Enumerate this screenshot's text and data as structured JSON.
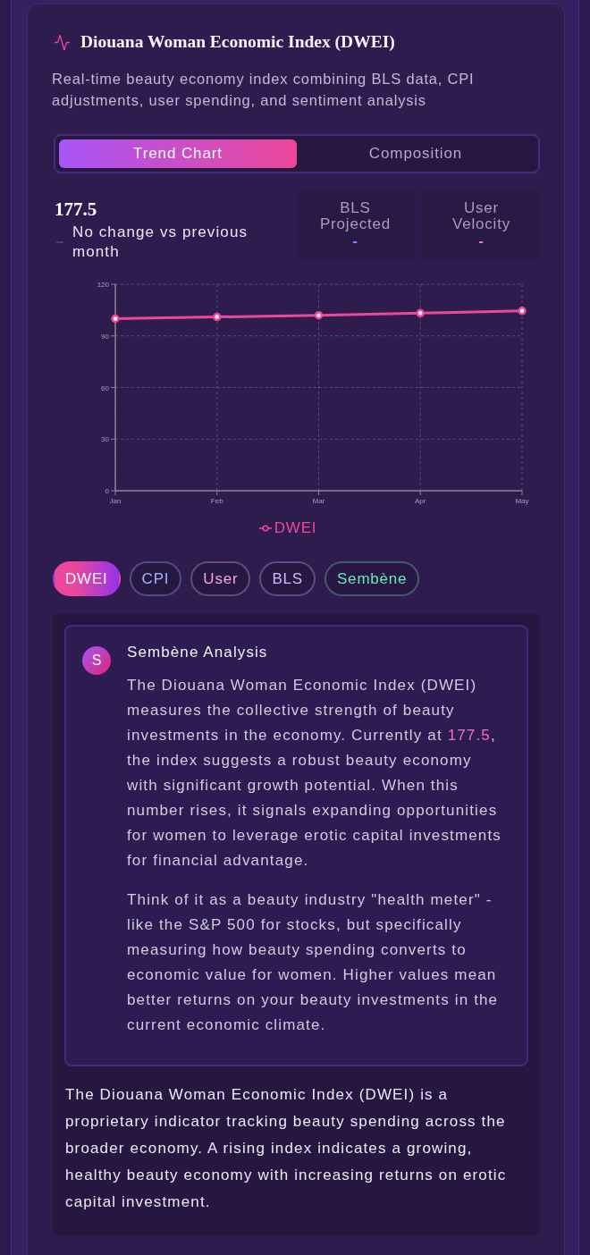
{
  "header": {
    "title": "Diouana Woman Economic Index (DWEI)",
    "subtitle": "Real-time beauty economy index combining BLS data, CPI adjustments, user spending, and sentiment analysis"
  },
  "tabs": [
    {
      "label": "Trend Chart",
      "selected": true
    },
    {
      "label": "Composition",
      "selected": false
    }
  ],
  "summary": {
    "value": "177.5",
    "change": "No change vs previous month"
  },
  "stats": [
    {
      "label": "BLS Projected",
      "value": "-",
      "color": "#818cf8"
    },
    {
      "label": "User Velocity",
      "value": "-",
      "color": "#f472b6"
    }
  ],
  "chart": {
    "chart_data": {
      "type": "line",
      "grid": true,
      "categories": [
        "Jan",
        "Feb",
        "Mar",
        "Apr",
        "May"
      ],
      "series": [
        {
          "name": "DWEI",
          "color": "#ec4899",
          "marker": "circle",
          "values": [
            100,
            101,
            102,
            103.2,
            104.5
          ]
        }
      ],
      "ylim": [
        0,
        120
      ],
      "yticks": [
        0,
        30,
        60,
        90,
        120
      ]
    }
  },
  "filters": [
    {
      "label": "DWEI",
      "selected": true,
      "color": "#ec4899"
    },
    {
      "label": "CPI",
      "selected": false,
      "color": "#a5b4fc"
    },
    {
      "label": "User",
      "selected": false,
      "color": "#f9a8d4"
    },
    {
      "label": "BLS",
      "selected": false,
      "color": "#d8b4fe"
    },
    {
      "label": "Sembène",
      "selected": false,
      "color": "#6ee7b7"
    }
  ],
  "analysis": {
    "avatar": "S",
    "title": "Sembène Analysis",
    "paragraphs": [
      {
        "segments": [
          {
            "text": "The Diouana Woman Economic Index (DWEI) measures the collective strength of beauty investments in the economy. Currently at ",
            "highlight": false
          },
          {
            "text": "177.5",
            "highlight": true
          },
          {
            "text": ", the index suggests a robust beauty economy with significant growth potential. When this number rises, it signals expanding opportunities for women to leverage erotic capital investments for financial advantage.",
            "highlight": false
          }
        ]
      },
      {
        "segments": [
          {
            "text": "Think of it as a beauty industry \"health meter\" - like the S&P 500 for stocks, but specifically measuring how beauty spending converts to economic value for women. Higher values mean better returns on your beauty investments in the current economic climate.",
            "highlight": false
          }
        ]
      }
    ]
  },
  "description": "The Diouana Woman Economic Index (DWEI) is a proprietary indicator tracking beauty spending across the broader economy. A rising index indicates a growing, healthy beauty economy with increasing returns on erotic capital investment."
}
